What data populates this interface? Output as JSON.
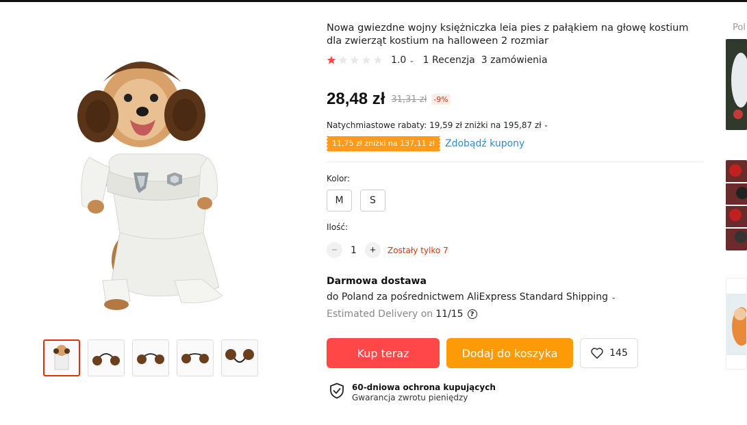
{
  "product": {
    "title": "Nowa gwiezdne wojny księżniczka leia pies z pałąkiem na głowę kostium dla zwierząt kostium na halloween 2 rozmiar",
    "rating_value": "1.0",
    "rating_stars": 1,
    "reviews": "1 Recenzja",
    "orders": "3 zamówienia"
  },
  "pricing": {
    "price": "28,48 zł",
    "old_price": "31,31 zł",
    "discount": "-9%",
    "instant_discount": "Natychmiastowe rabaty: 19,59 zł zniżki na 195,87 zł",
    "coupon": "11,75 zł zniżki na 137,11 zł",
    "coupon_link": "Zdobądź kupony"
  },
  "variants": {
    "color_label": "Kolor:",
    "options": [
      "M",
      "S"
    ]
  },
  "quantity": {
    "label": "Ilość:",
    "value": "1",
    "minus": "−",
    "plus": "+",
    "note": "Zostały tylko 7"
  },
  "shipping": {
    "title": "Darmowa dostawa",
    "line": "do Poland za pośrednictwem AliExpress Standard Shipping",
    "estimated_label": "Estimated Delivery on",
    "estimated_date": "11/15",
    "help": "?"
  },
  "actions": {
    "buy": "Kup teraz",
    "cart": "Dodaj do koszyka",
    "wishlist_count": "145"
  },
  "protection": {
    "title": "60-dniowa ochrona kupujących",
    "subtitle": "Gwarancja zwrotu pieniędzy"
  },
  "rail": {
    "title": "Pol"
  },
  "colors": {
    "accent_red": "#ff4747",
    "accent_orange": "#fd9a08",
    "link_blue": "#2e8bc9",
    "discount_red": "#e62e04"
  },
  "icons": {
    "chevron": "chevron-down-icon",
    "heart": "heart-icon",
    "shield": "shield-check-icon",
    "star": "star-icon"
  }
}
